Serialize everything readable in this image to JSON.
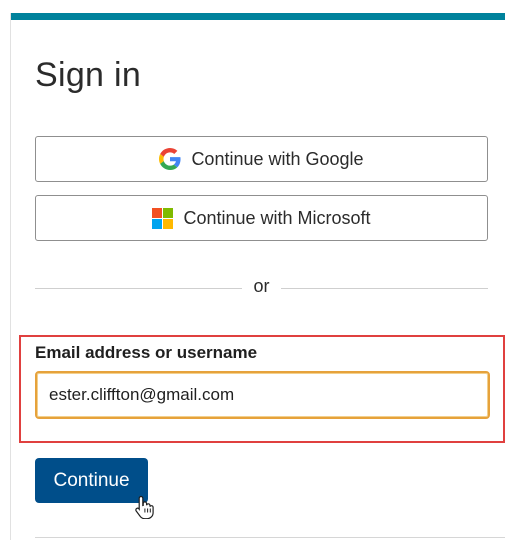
{
  "page": {
    "title": "Sign in",
    "accent_color": "#00829c"
  },
  "providers": {
    "google_label": "Continue with Google",
    "google_icon": "google-icon",
    "microsoft_label": "Continue with Microsoft",
    "microsoft_icon": "microsoft-icon"
  },
  "divider": {
    "text": "or"
  },
  "form": {
    "email_label": "Email address or username",
    "email_value": "ester.cliffton@gmail.com",
    "continue_label": "Continue",
    "continue_color": "#004e8a",
    "highlight_color": "#e0403f",
    "focus_color": "#e6a23c"
  }
}
